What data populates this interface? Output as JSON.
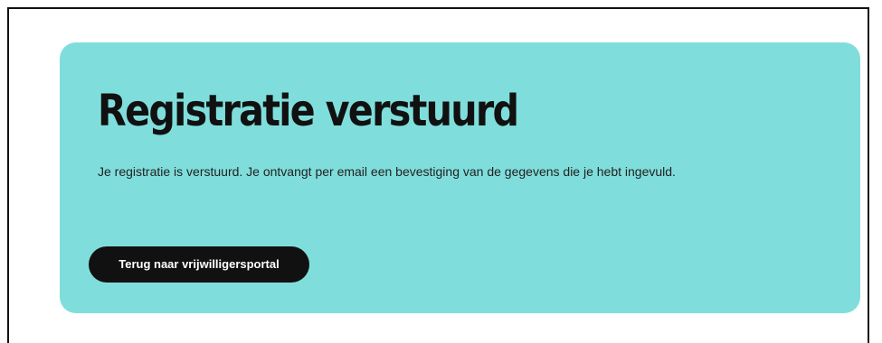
{
  "card": {
    "title": "Registratie verstuurd",
    "message": "Je registratie is verstuurd. Je ontvangt per email een bevestiging van de gegevens die je hebt ingevuld.",
    "back_button_label": "Terug naar vrijwilligersportal"
  },
  "colors": {
    "card_background": "#7fdedb",
    "button_background": "#111111",
    "text": "#111111"
  }
}
